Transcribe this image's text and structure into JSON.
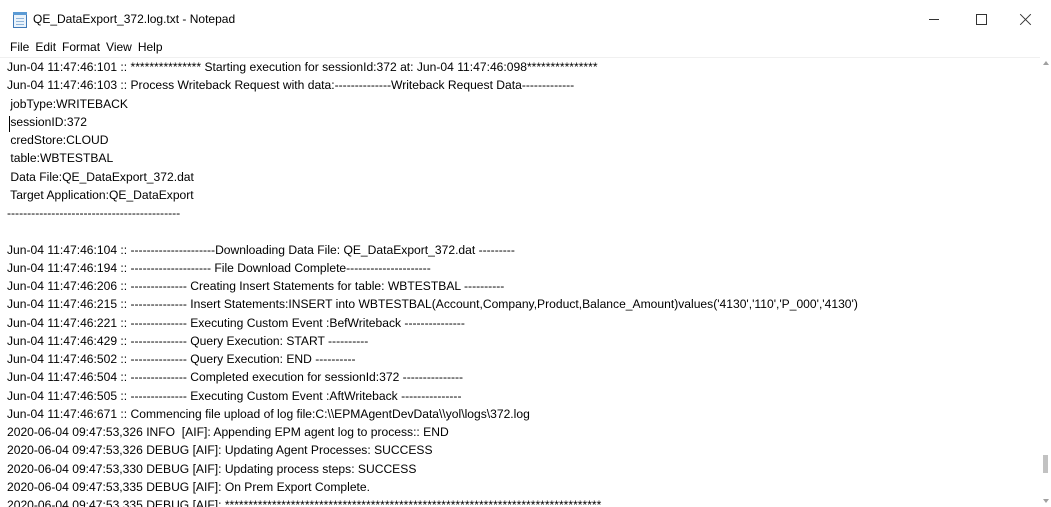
{
  "window": {
    "title": "QE_DataExport_372.log.txt - Notepad",
    "controls": [
      "minimize",
      "maximize",
      "close"
    ]
  },
  "menu": {
    "items": [
      "File",
      "Edit",
      "Format",
      "View",
      "Help"
    ]
  },
  "editor": {
    "lines": [
      "Jun-04 11:47:46:101 :: *************** Starting execution for sessionId:372 at: Jun-04 11:47:46:098***************",
      "Jun-04 11:47:46:103 :: Process Writeback Request with data:--------------Writeback Request Data-------------",
      " jobType:WRITEBACK",
      " sessionID:372",
      " credStore:CLOUD",
      " table:WBTESTBAL",
      " Data File:QE_DataExport_372.dat",
      " Target Application:QE_DataExport",
      "-------------------------------------------",
      "",
      "Jun-04 11:47:46:104 :: ---------------------Downloading Data File: QE_DataExport_372.dat ---------",
      "Jun-04 11:47:46:194 :: -------------------- File Download Complete---------------------",
      "Jun-04 11:47:46:206 :: -------------- Creating Insert Statements for table: WBTESTBAL ----------",
      "Jun-04 11:47:46:215 :: -------------- Insert Statements:INSERT into WBTESTBAL(Account,Company,Product,Balance_Amount)values('4130','110','P_000','4130')",
      "Jun-04 11:47:46:221 :: -------------- Executing Custom Event :BefWriteback ---------------",
      "Jun-04 11:47:46:429 :: -------------- Query Execution: START ----------",
      "Jun-04 11:47:46:502 :: -------------- Query Execution: END ----------",
      "Jun-04 11:47:46:504 :: -------------- Completed execution for sessionId:372 ---------------",
      "Jun-04 11:47:46:505 :: -------------- Executing Custom Event :AftWriteback ---------------",
      "Jun-04 11:47:46:671 :: Commencing file upload of log file:C:\\\\EPMAgentDevData\\\\yol\\logs\\372.log",
      "2020-06-04 09:47:53,326 INFO  [AIF]: Appending EPM agent log to process:: END",
      "2020-06-04 09:47:53,326 DEBUG [AIF]: Updating Agent Processes: SUCCESS",
      "2020-06-04 09:47:53,330 DEBUG [AIF]: Updating process steps: SUCCESS",
      "2020-06-04 09:47:53,335 DEBUG [AIF]: On Prem Export Complete.",
      "2020-06-04 09:47:53,335 DEBUG [AIF]: ********************************************************************************"
    ]
  }
}
